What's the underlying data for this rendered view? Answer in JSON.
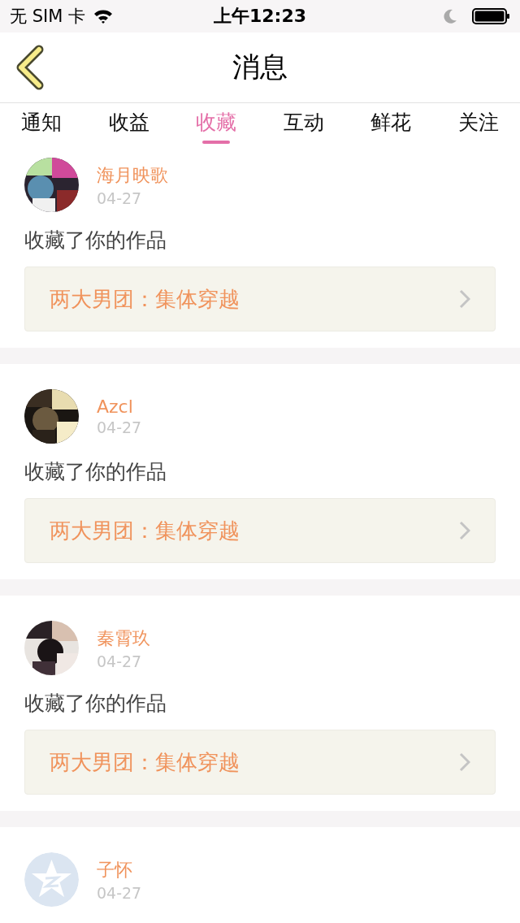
{
  "status_bar": {
    "carrier": "无 SIM 卡",
    "time": "上午12:23"
  },
  "nav": {
    "title": "消息"
  },
  "tabs": [
    {
      "label": "通知",
      "selected": false
    },
    {
      "label": "收益",
      "selected": false
    },
    {
      "label": "收藏",
      "selected": true
    },
    {
      "label": "互动",
      "selected": false
    },
    {
      "label": "鲜花",
      "selected": false
    },
    {
      "label": "关注",
      "selected": false
    }
  ],
  "messages": [
    {
      "name": "海月映歌",
      "date": "04-27",
      "action": "收藏了你的作品",
      "work": "两大男团：集体穿越"
    },
    {
      "name": "Azcl",
      "date": "04-27",
      "action": "收藏了你的作品",
      "work": "两大男团：集体穿越"
    },
    {
      "name": "秦霄玖",
      "date": "04-27",
      "action": "收藏了你的作品",
      "work": "两大男团：集体穿越"
    },
    {
      "avatar": {
        "kind": "default"
      },
      "name": "子怀",
      "date": "04-27"
    }
  ]
}
